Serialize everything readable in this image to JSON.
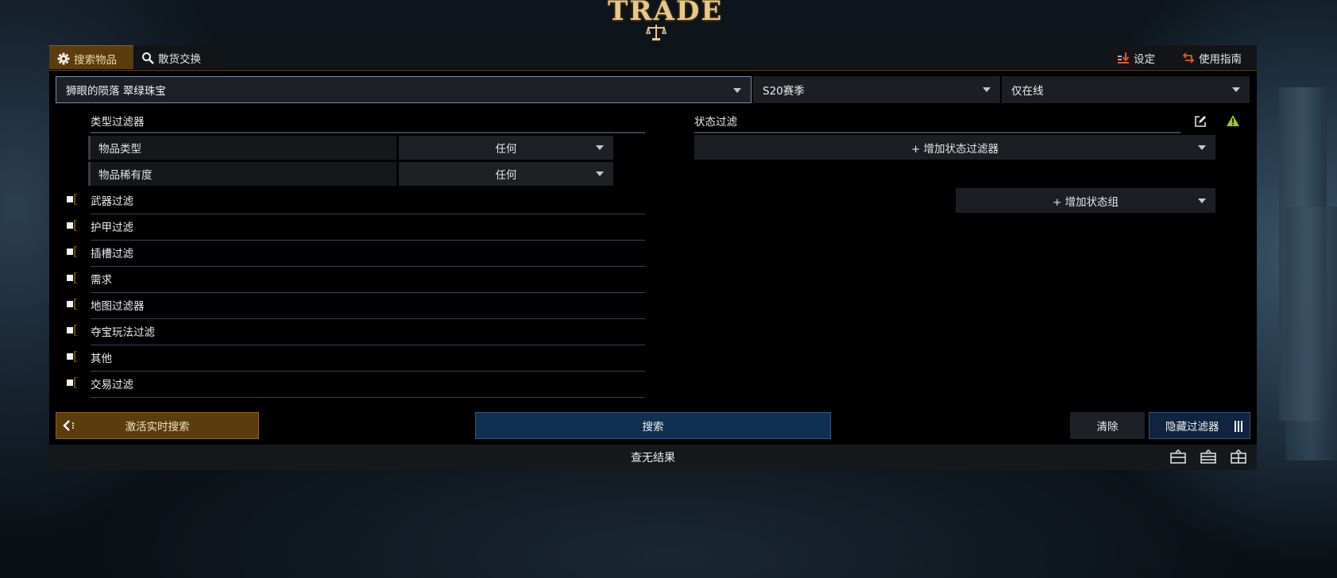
{
  "logo": {
    "text": "TRADE"
  },
  "tabs": {
    "search_items": "搜索物品",
    "bulk_exchange": "散货交换",
    "settings": "设定",
    "guide": "使用指南"
  },
  "search_bar": {
    "item_value": "狮眼的陨落 翠绿珠宝",
    "league": "S20赛季",
    "online_status": "仅在线"
  },
  "type_filters": {
    "title": "类型过滤器",
    "item_type_label": "物品类型",
    "item_type_value": "任何",
    "rarity_label": "物品稀有度",
    "rarity_value": "任何"
  },
  "filter_groups": [
    "武器过滤",
    "护甲过滤",
    "插槽过滤",
    "需求",
    "地图过滤器",
    "夺宝玩法过滤",
    "其他",
    "交易过滤"
  ],
  "stat_filters": {
    "title": "状态过滤",
    "add_stat_filter": "+ 增加状态过滤器",
    "add_stat_group": "+ 增加状态组"
  },
  "actions": {
    "live_search": "激活实时搜索",
    "search": "搜索",
    "clear": "清除",
    "hide_filters": "隐藏过滤器"
  },
  "status": {
    "message": "查无结果"
  },
  "colors": {
    "accent_orange": "#5a3c0d",
    "search_blue": "#0f3052",
    "warning": "#9ccc1d"
  },
  "icons": [
    "gear-icon",
    "search-icon",
    "settings-download-icon",
    "swap-arrows-icon",
    "chevron-left-icon",
    "edit-icon",
    "warning-icon",
    "layout-icon"
  ]
}
